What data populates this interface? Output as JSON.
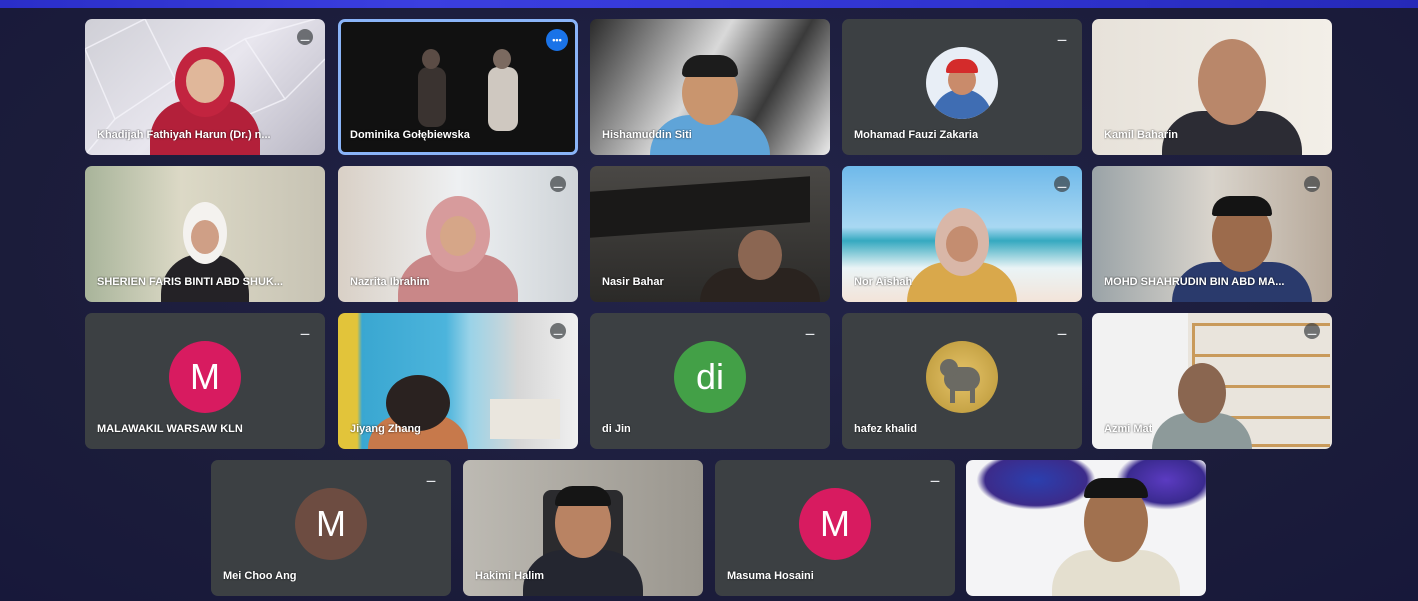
{
  "meeting": {
    "participants": [
      {
        "name": "Khadijah Fathiyah Harun (Dr.) n...",
        "type": "video",
        "mic": "muted"
      },
      {
        "name": "Dominika Gołębiewska",
        "type": "video",
        "speaking": true
      },
      {
        "name": "Hishamuddin Siti",
        "type": "video",
        "mic": "none"
      },
      {
        "name": "Mohamad Fauzi Zakaria",
        "type": "photo",
        "mic": "muted"
      },
      {
        "name": "Kamil Baharin",
        "type": "video",
        "mic": "none"
      },
      {
        "name": "SHERIEN FARIS BINTI ABD SHUK...",
        "type": "video",
        "mic": "none"
      },
      {
        "name": "Nazrita Ibrahim",
        "type": "video",
        "mic": "muted"
      },
      {
        "name": "Nasir Bahar",
        "type": "video",
        "mic": "none"
      },
      {
        "name": "Nor Aishah",
        "type": "video",
        "mic": "muted"
      },
      {
        "name": "MOHD SHAHRUDIN BIN ABD MA...",
        "type": "video",
        "mic": "muted"
      },
      {
        "name": "MALAWAKIL WARSAW KLN",
        "type": "initial",
        "initial": "M",
        "color": "#d81b60",
        "mic": "muted"
      },
      {
        "name": "Jiyang Zhang",
        "type": "video",
        "mic": "muted"
      },
      {
        "name": "di Jin",
        "type": "initial",
        "initial": "di",
        "color": "#43a047",
        "mic": "muted"
      },
      {
        "name": "hafez khalid",
        "type": "photo",
        "mic": "muted"
      },
      {
        "name": "Azmi Mat",
        "type": "video",
        "mic": "muted"
      },
      {
        "name": "Mei Choo Ang",
        "type": "initial",
        "initial": "M",
        "color": "#6d4c41",
        "mic": "muted"
      },
      {
        "name": "Hakimi Halim",
        "type": "video",
        "mic": "none"
      },
      {
        "name": "Masuma Hosaini",
        "type": "initial",
        "initial": "M",
        "color": "#d81b60",
        "mic": "muted"
      },
      {
        "name": "",
        "type": "video",
        "mic": "none"
      }
    ]
  },
  "icons": {
    "mic_muted": "mic-off-icon",
    "speaking": "audio-level-icon"
  },
  "colors": {
    "background": "#1e1f3f",
    "tile": "#3c4043",
    "speaking_border": "#8ab4f8",
    "accent": "#3b3fe0"
  }
}
